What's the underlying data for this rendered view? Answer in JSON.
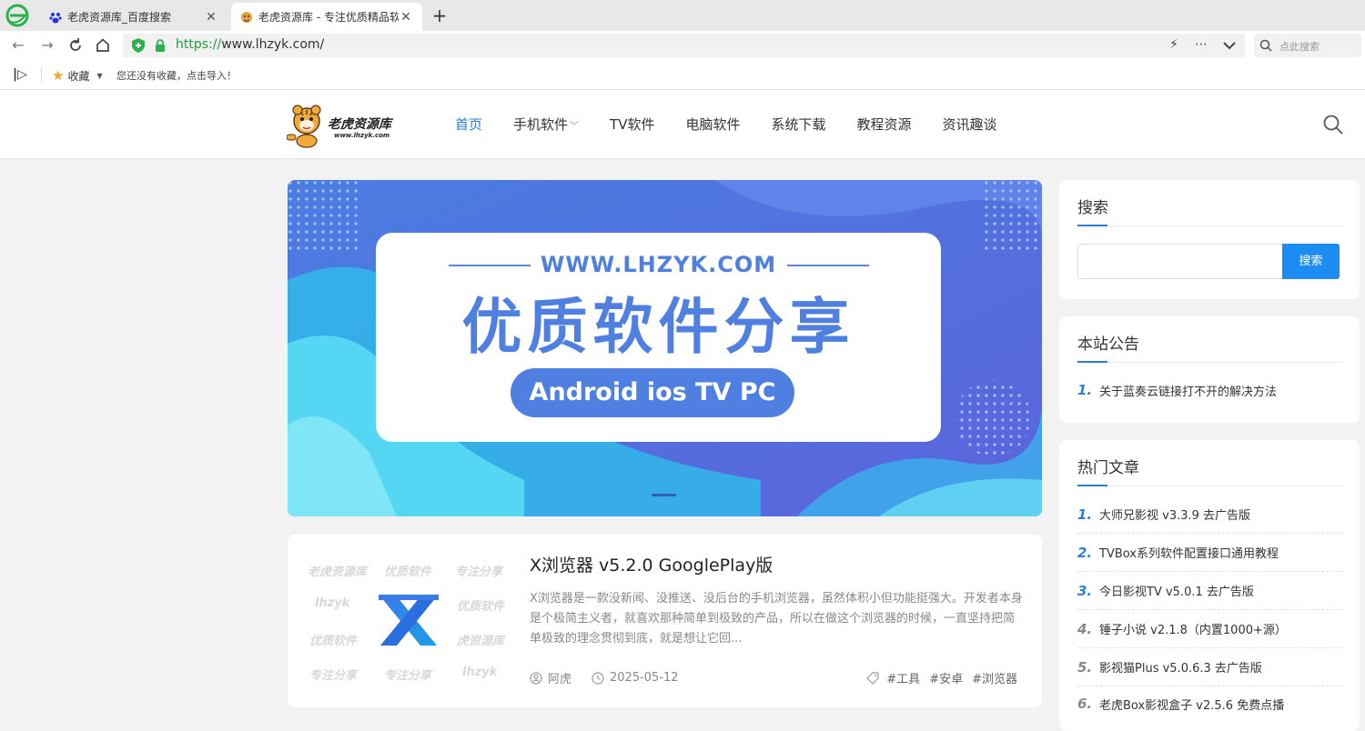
{
  "browser": {
    "tabs": [
      {
        "title": "老虎资源库_百度搜索",
        "active": false
      },
      {
        "title": "老虎资源库 - 专注优质精品软",
        "active": true
      }
    ],
    "new_tab": "+",
    "url_scheme": "https://",
    "url_host": "www.lhzyk.com/",
    "search_placeholder": "点此搜索",
    "bookmarks_label": "收藏",
    "bookmarks_hint": "您还没有收藏，点击导入！"
  },
  "site": {
    "nav": [
      {
        "label": "首页",
        "active": true
      },
      {
        "label": "手机软件",
        "dropdown": true
      },
      {
        "label": "TV软件"
      },
      {
        "label": "电脑软件"
      },
      {
        "label": "系统下载"
      },
      {
        "label": "教程资源"
      },
      {
        "label": "资讯趣谈"
      }
    ],
    "nav_dropdown_arrow": "﹀"
  },
  "banner": {
    "url": "WWW.LHZYK.COM",
    "title": "优质软件分享",
    "platforms": "Android ios TV PC"
  },
  "post": {
    "title": "X浏览器 v5.2.0 GooglePlay版",
    "excerpt": "X浏览器是一款没新闻、没推送、没后台的手机浏览器，虽然体积小但功能挺强大。开发者本身是个极简主义者，就喜欢那种简单到极致的产品，所以在做这个浏览器的时候，一直坚持把简单极致的理念贯彻到底，就是想让它回...",
    "author": "阿虎",
    "date": "2025-05-12",
    "tags": [
      "#工具",
      "#安卓",
      "#浏览器"
    ],
    "watermarks": [
      "老虎资源库",
      "优质软件",
      "专注分享",
      "lhzyk",
      "优质软件",
      "优质软件",
      "虎资源库",
      "专注分享",
      "专注分享",
      "lhzyk"
    ]
  },
  "sidebar": {
    "search": {
      "title": "搜索",
      "button": "搜索"
    },
    "notice": {
      "title": "本站公告",
      "items": [
        {
          "num": "1.",
          "text": "关于蓝奏云链接打不开的解决方法"
        }
      ]
    },
    "hot": {
      "title": "热门文章",
      "items": [
        {
          "num": "1.",
          "text": "大师兄影视 v3.3.9 去广告版"
        },
        {
          "num": "2.",
          "text": "TVBox系列软件配置接口通用教程"
        },
        {
          "num": "3.",
          "text": "今日影视TV v5.0.1 去广告版"
        },
        {
          "num": "4.",
          "text": "锤子小说 v2.1.8（内置1000+源）"
        },
        {
          "num": "5.",
          "text": "影视猫Plus v5.0.6.3 去广告版"
        },
        {
          "num": "6.",
          "text": "老虎Box影视盒子 v2.5.6 免费点播"
        }
      ]
    },
    "rank_colors": [
      "#2a7fd4",
      "#2a7fd4",
      "#2a7fd4",
      "#888888",
      "#888888",
      "#888888"
    ]
  }
}
